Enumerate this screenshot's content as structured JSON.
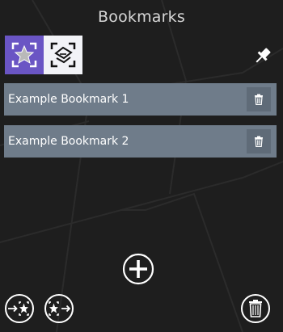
{
  "panel": {
    "title": "Bookmarks"
  },
  "toolbar": {
    "saved_tab_icon": "star-bookmark-icon",
    "capture_tab_icon": "add-bookmark-extent-icon",
    "pin_icon": "pin-icon",
    "accent": "#6a55c4"
  },
  "bookmarks": [
    {
      "label": "Example Bookmark 1",
      "icon": "delete-icon"
    },
    {
      "label": "Example Bookmark 2",
      "icon": "delete-icon"
    }
  ],
  "footer": {
    "add_icon": "add-icon",
    "import_icon": "import-bookmarks-icon",
    "export_icon": "export-bookmarks-icon",
    "delete_all_icon": "delete-all-icon"
  }
}
